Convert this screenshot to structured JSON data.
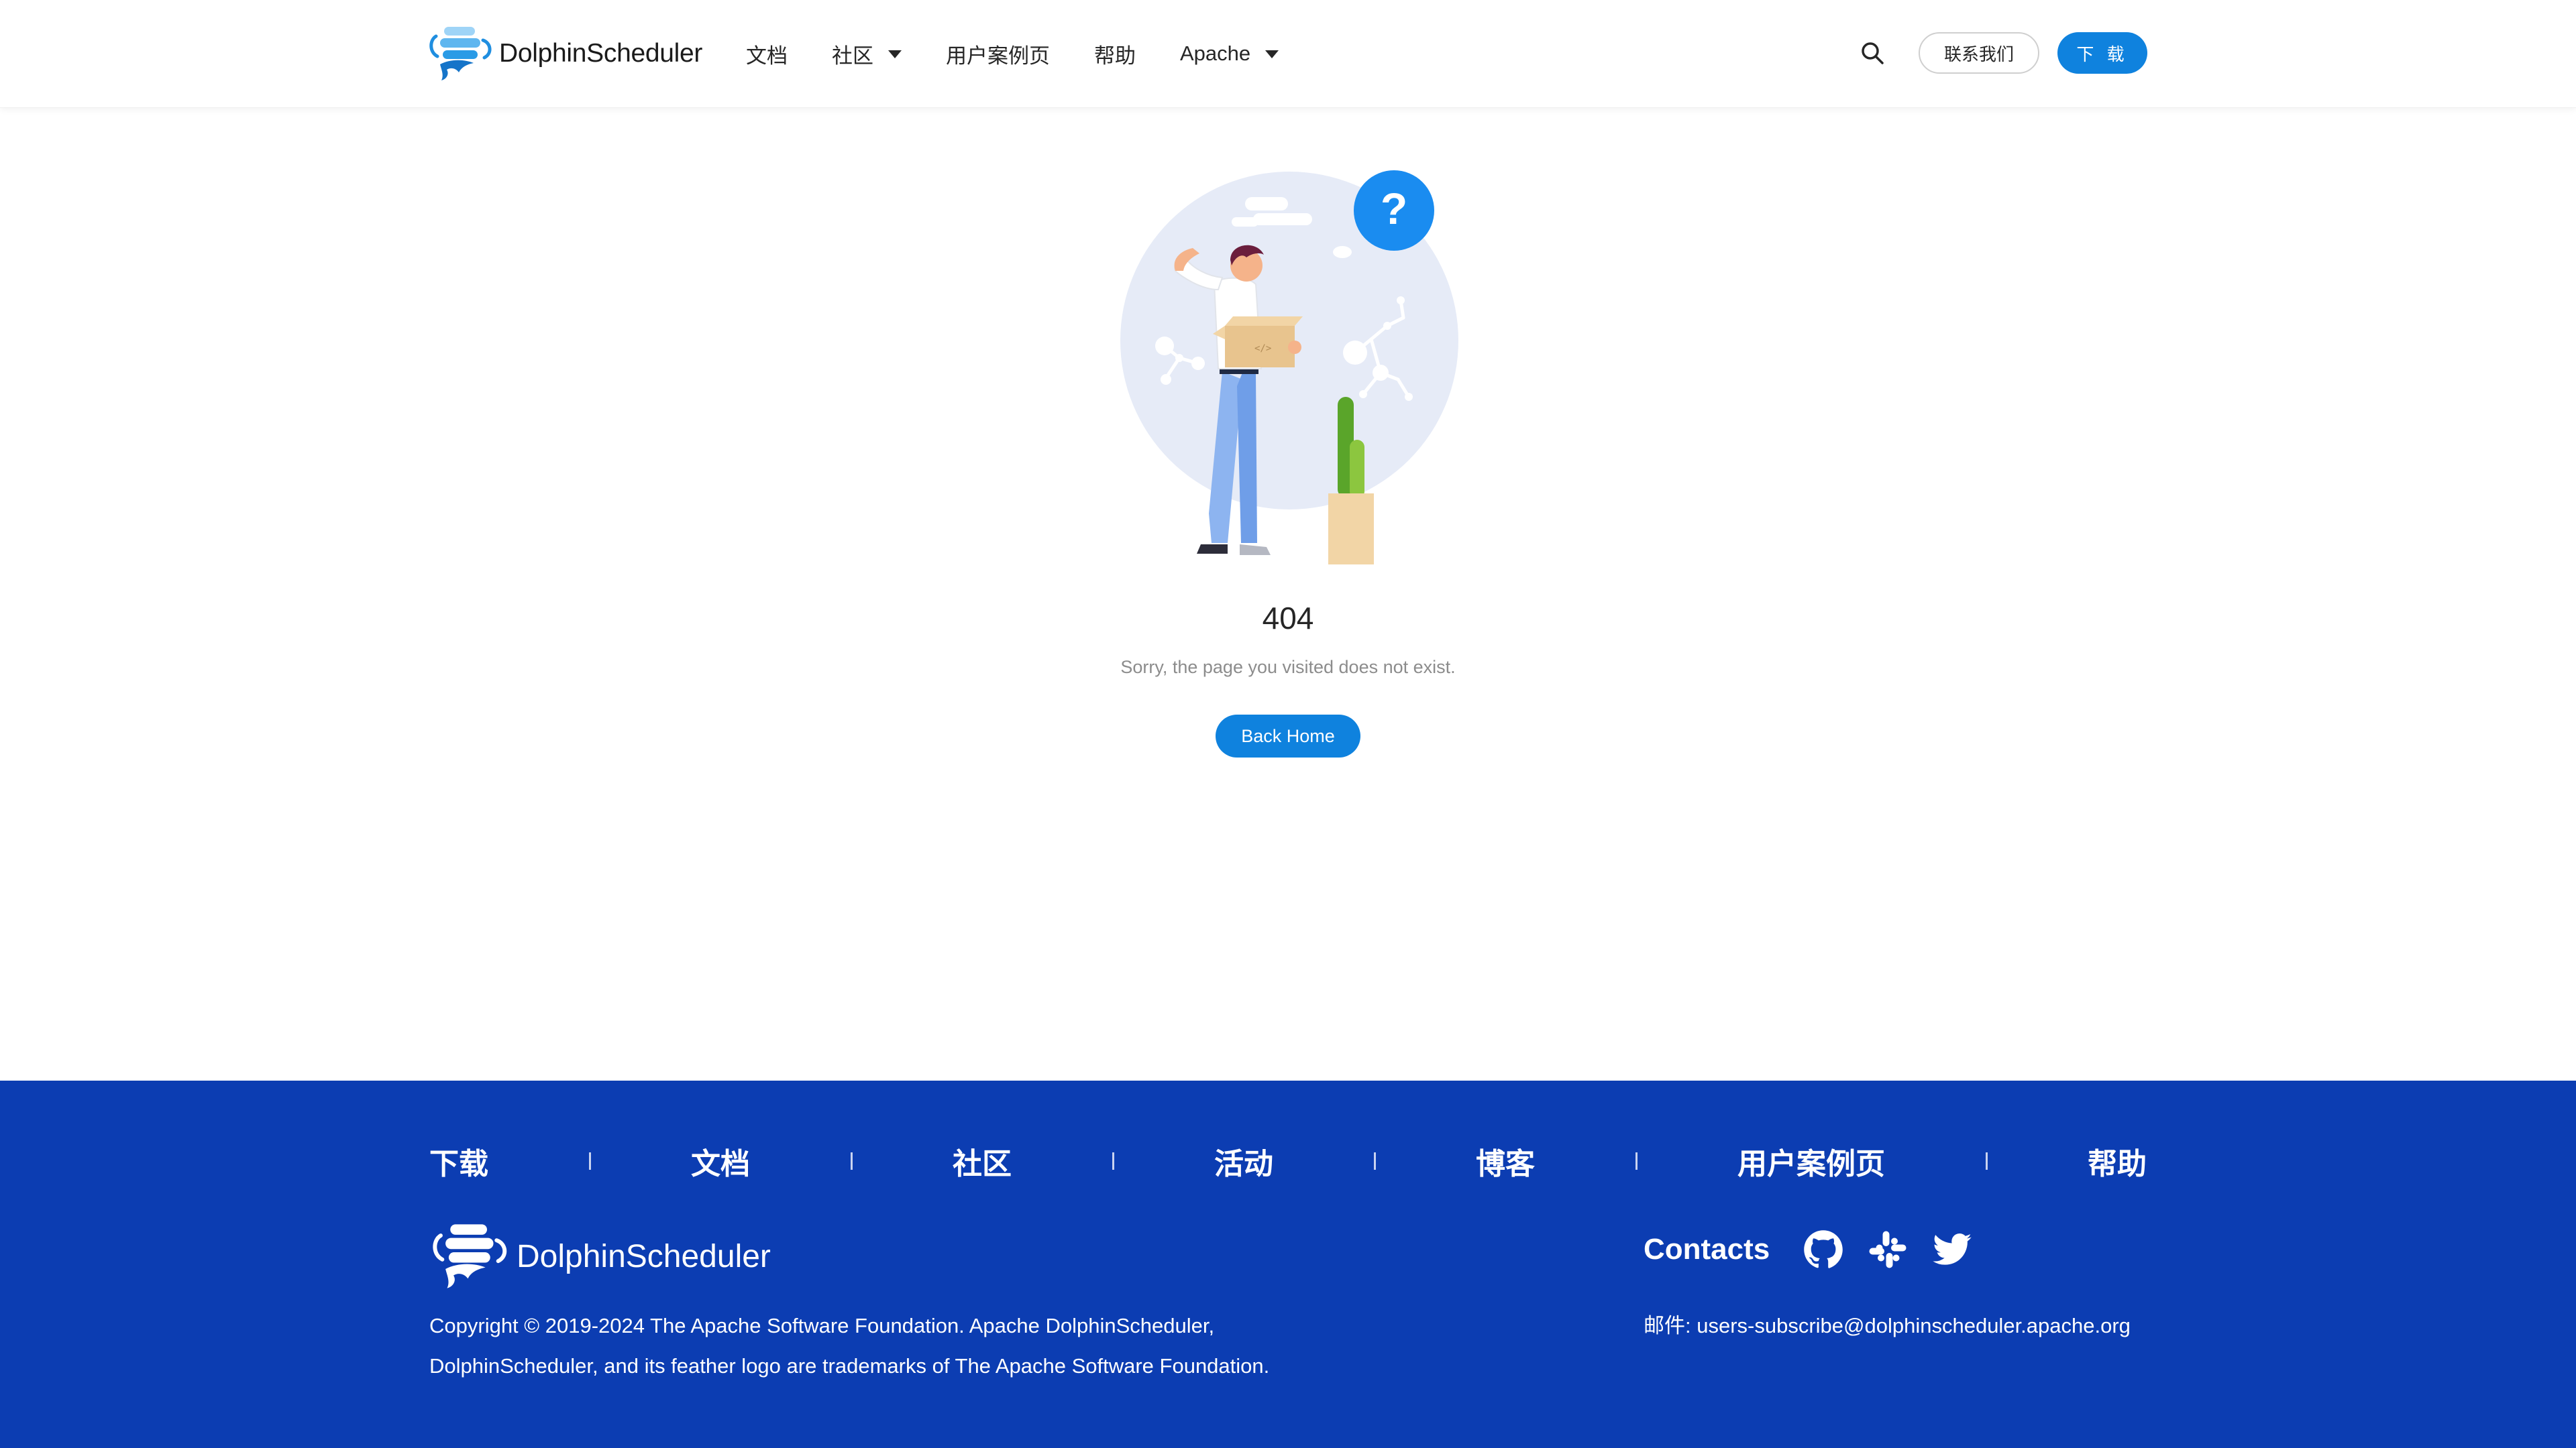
{
  "header": {
    "logo_text": "DolphinScheduler",
    "nav": [
      {
        "label": "文档",
        "dropdown": false
      },
      {
        "label": "社区",
        "dropdown": true
      },
      {
        "label": "用户案例页",
        "dropdown": false
      },
      {
        "label": "帮助",
        "dropdown": false
      },
      {
        "label": "Apache",
        "dropdown": true
      }
    ],
    "search_icon": "search-icon",
    "contact_label": "联系我们",
    "download_label": "下 载"
  },
  "error": {
    "code": "404",
    "message": "Sorry, the page you visited does not exist.",
    "back_home_label": "Back Home",
    "illustration": "confused-person-with-box",
    "badge_text": "?"
  },
  "footer": {
    "nav": [
      "下载",
      "文档",
      "社区",
      "活动",
      "博客",
      "用户案例页",
      "帮助"
    ],
    "logo_text": "DolphinScheduler",
    "copyright": "Copyright © 2019-2024 The Apache Software Foundation. Apache DolphinScheduler, DolphinScheduler, and its feather logo are trademarks of The Apache Software Foundation.",
    "contacts_title": "Contacts",
    "social_icons": [
      "github-icon",
      "slack-icon",
      "twitter-icon"
    ],
    "email": "邮件: users-subscribe@dolphinscheduler.apache.org"
  },
  "colors": {
    "primary": "#0f82de",
    "footer_bg": "#0c3db2",
    "illustration_circle": "#e6ebf7",
    "badge": "#1a8cf0"
  }
}
